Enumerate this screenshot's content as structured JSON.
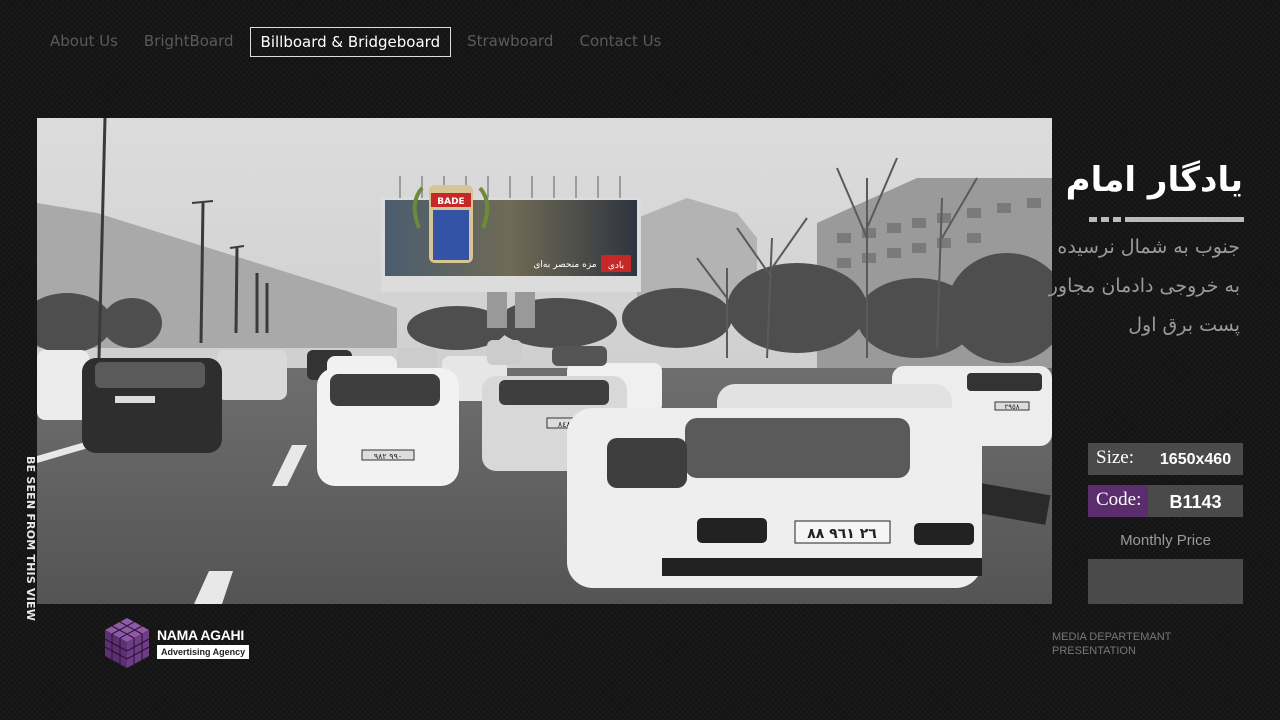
{
  "nav": {
    "items": [
      {
        "label": "About Us"
      },
      {
        "label": "BrightBoard"
      },
      {
        "label": "Billboard & Bridgeboard"
      },
      {
        "label": "Strawboard"
      },
      {
        "label": "Contact Us"
      }
    ],
    "active_index": 2
  },
  "photo": {
    "side_caption": "BE SEEN FROM THIS VIEW",
    "billboard_brand": "BADE",
    "billboard_slogan": "مزه منحصر به‌ای",
    "billboard_logo": "بادی",
    "plates": [
      "٢٦ ٩٦١ ٨٨",
      "٩١٣ ٨٤٨",
      "٩٩٠ ٩٨٢",
      "٢٩٥٨"
    ]
  },
  "location": {
    "title": "یادگار امام",
    "description": "جنوب به شمال نرسیده به خروجی دادمان مجاور پست برق اول"
  },
  "specs": {
    "size_label": "Size:",
    "size_value": "1650x460",
    "code_label": "Code:",
    "code_value": "B1143",
    "price_label": "Monthly Price",
    "price_value": ""
  },
  "brand": {
    "name": "NAMA AGAHI",
    "tagline": "Advertising Agency"
  },
  "footer": {
    "line1": "MEDIA DEPARTEMANT",
    "line2": "PRESENTATION"
  },
  "colors": {
    "background": "#141414",
    "accent": "#5c2d6c",
    "panel": "#4a4a4a",
    "logo_purple": "#6b3d7d"
  }
}
